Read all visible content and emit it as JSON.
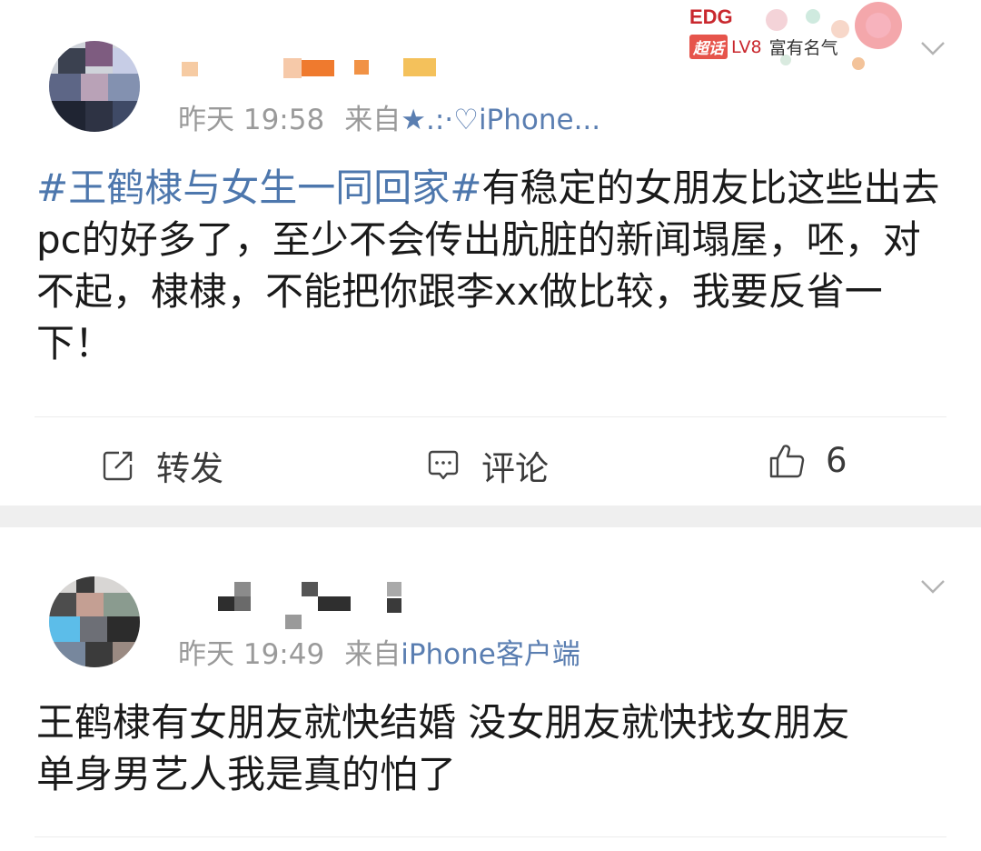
{
  "posts": [
    {
      "meta": {
        "time": "昨天 19:58",
        "source_prefix": "来自",
        "source": "★.:·♡iPhone..."
      },
      "badge": {
        "team": "EDG",
        "super_topic": "超话",
        "level": "LV8",
        "title": "富有名气"
      },
      "content": {
        "topic": "#王鹤棣与女生一同回家#",
        "text": "有稳定的女朋友比这些出去pc的好多了，至少不会传出肮脏的新闻塌屋，呸，对不起，棣棣，不能把你跟李xx做比较，我要反省一下！"
      },
      "actions": {
        "repost": "转发",
        "comment": "评论",
        "like": "6"
      }
    },
    {
      "meta": {
        "time": "昨天 19:49",
        "source_prefix": "来自",
        "source": "iPhone客户端"
      },
      "content": {
        "text_line1": "王鹤棣有女朋友就快结婚 没女朋友就快找女朋友",
        "text_line2": "单身男艺人我是真的怕了"
      }
    }
  ],
  "colors": {
    "topic": "#4d77ad",
    "source": "#5a7eb1",
    "meta": "#9a9a9a",
    "separator": "#efefef"
  },
  "icons": {
    "expand": "chevron-down-icon",
    "repost": "repost-icon",
    "comment": "comment-icon",
    "like": "thumbs-up-icon"
  }
}
